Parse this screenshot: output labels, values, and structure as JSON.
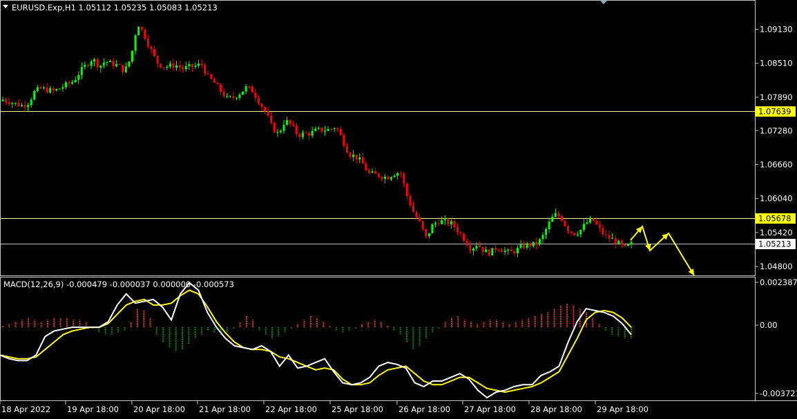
{
  "header": {
    "symbol_line": "EURUSD.Exp,H1  1.05112 1.05235 1.05083 1.05213",
    "macd_line": "MACD(12,26,9) -0.000479 -0.000037 0.000000 -0.000573"
  },
  "colors": {
    "background": "#000000",
    "bull": "#00ff00",
    "bear": "#ff0000",
    "hline": "#ffff99",
    "price_line": "#c0c0c0",
    "macd_line": "#ffffff",
    "signal_line": "#ffff00",
    "hist_pos": "#ff4040",
    "hist_neg": "#00a000",
    "arrow": "#ffff00",
    "label_yellow": "#ffff00"
  },
  "chart_data": {
    "type": "candlestick",
    "price_axis": {
      "ticks": [
        "1.09130",
        "1.08510",
        "1.07890",
        "1.07280",
        "1.06660",
        "1.06040",
        "1.05420",
        "1.04800"
      ],
      "ylim": [
        1.0465,
        1.0964
      ]
    },
    "time_axis": {
      "ticks": [
        "18 Apr 2022",
        "19 Apr 18:00",
        "20 Apr 18:00",
        "21 Apr 18:00",
        "22 Apr 18:00",
        "25 Apr 18:00",
        "26 Apr 18:00",
        "27 Apr 18:00",
        "28 Apr 18:00",
        "29 Apr 18:00"
      ]
    },
    "horizontal_levels": [
      {
        "label": "1.07639",
        "value": 1.07639,
        "highlight": true
      },
      {
        "label": "1.05678",
        "value": 1.05678,
        "highlight": true
      },
      {
        "label": "1.05213",
        "value": 1.05213,
        "highlight": false
      }
    ],
    "close_path": [
      1.0785,
      1.0781,
      1.0777,
      1.0774,
      1.0779,
      1.08,
      1.0805,
      1.0802,
      1.08,
      1.0806,
      1.0812,
      1.0818,
      1.0835,
      1.0848,
      1.086,
      1.0845,
      1.0855,
      1.085,
      1.0847,
      1.0836,
      1.0862,
      1.0925,
      1.0904,
      1.0878,
      1.0853,
      1.0845,
      1.0846,
      1.0848,
      1.0841,
      1.0844,
      1.0846,
      1.0849,
      1.0826,
      1.0815,
      1.08,
      1.0786,
      1.0789,
      1.0797,
      1.0807,
      1.08,
      1.078,
      1.0761,
      1.0734,
      1.0721,
      1.0747,
      1.0738,
      1.072,
      1.0722,
      1.0723,
      1.0729,
      1.0729,
      1.073,
      1.0736,
      1.071,
      1.0685,
      1.0681,
      1.067,
      1.065,
      1.0648,
      1.0645,
      1.0643,
      1.065,
      1.0652,
      1.061,
      1.058,
      1.056,
      1.0532,
      1.0555,
      1.0563,
      1.0561,
      1.0558,
      1.0545,
      1.053,
      1.0512,
      1.0522,
      1.0508,
      1.0505,
      1.0515,
      1.051,
      1.0505,
      1.0509,
      1.0517,
      1.052,
      1.052,
      1.053,
      1.0555,
      1.0575,
      1.0571,
      1.0549,
      1.054,
      1.0545,
      1.056,
      1.0565,
      1.0548,
      1.0535,
      1.053,
      1.0522,
      1.0513,
      1.0521
    ],
    "macd": {
      "ylim": [
        -0.003721,
        0.002387
      ],
      "ticks": [
        "0.002387",
        "0.00",
        "-0.003721"
      ],
      "macd_path": [
        -0.0015,
        -0.0017,
        -0.0018,
        -0.0018,
        -0.0015,
        -0.0005,
        -0.0002,
        -0.0001,
        0.0,
        0.0,
        0.0,
        0.0,
        0.0003,
        0.0012,
        0.0018,
        0.0013,
        0.0014,
        0.0015,
        0.0011,
        0.0004,
        0.0018,
        0.0024,
        0.002,
        0.0008,
        0.0,
        -0.0006,
        -0.001,
        -0.0011,
        -0.0012,
        -0.001,
        -0.0013,
        -0.0021,
        -0.0015,
        -0.0022,
        -0.0021,
        -0.0019,
        -0.0017,
        -0.0024,
        -0.003,
        -0.0031,
        -0.003,
        -0.0027,
        -0.0021,
        -0.0019,
        -0.002,
        -0.0022,
        -0.003,
        -0.0032,
        -0.0029,
        -0.0029,
        -0.0027,
        -0.0025,
        -0.0028,
        -0.0034,
        -0.0038,
        -0.0035,
        -0.0034,
        -0.0032,
        -0.0031,
        -0.0031,
        -0.0026,
        -0.0024,
        -0.0021,
        -0.0008,
        0.0003,
        0.001,
        0.0009,
        0.0008,
        0.0006,
        0.0002,
        -0.0004
      ],
      "signal_path": [
        -0.0015,
        -0.0016,
        -0.0017,
        -0.0017,
        -0.0016,
        -0.0012,
        -0.0008,
        -0.0004,
        -0.0002,
        -0.0001,
        0.0,
        0.0,
        0.0002,
        0.0007,
        0.0012,
        0.0014,
        0.0015,
        0.0012,
        0.0012,
        0.0013,
        0.0017,
        0.002,
        0.0018,
        0.0011,
        0.0003,
        -0.0003,
        -0.0008,
        -0.0011,
        -0.0012,
        -0.0012,
        -0.0013,
        -0.0016,
        -0.0017,
        -0.0019,
        -0.0021,
        -0.0023,
        -0.0022,
        -0.0023,
        -0.0028,
        -0.0031,
        -0.0031,
        -0.003,
        -0.0026,
        -0.0023,
        -0.0022,
        -0.0021,
        -0.0025,
        -0.0029,
        -0.0031,
        -0.0031,
        -0.0029,
        -0.0027,
        -0.0027,
        -0.003,
        -0.0033,
        -0.0034,
        -0.0035,
        -0.0034,
        -0.0033,
        -0.0032,
        -0.003,
        -0.0027,
        -0.0024,
        -0.0015,
        -0.0006,
        0.0004,
        0.0008,
        0.0009,
        0.0008,
        0.0005,
        0.0
      ],
      "histogram": [
        0.0001,
        0.0002,
        0.0003,
        0.0004,
        0.0005,
        0.0004,
        0.0003,
        0.0004,
        0.0005,
        0.0005,
        0.0005,
        0.0004,
        0.0004,
        0.0003,
        -0.0001,
        -0.0003,
        -0.0004,
        -0.0004,
        -0.0003,
        -0.0002,
        0.0003,
        0.001,
        0.0009,
        0.0005,
        -0.0004,
        -0.0008,
        -0.0011,
        -0.0013,
        -0.0012,
        -0.0009,
        -0.0006,
        -0.0004,
        -0.0002,
        -0.0003,
        -0.0004,
        -0.0003,
        -0.0001,
        0.0003,
        0.0006,
        0.0004,
        -0.0002,
        -0.0004,
        -0.0006,
        -0.0005,
        -0.0003,
        -0.0001,
        0.0002,
        0.0004,
        0.0006,
        0.0005,
        0.0003,
        0.0001,
        -0.0002,
        -0.0003,
        -0.0002,
        -0.0001,
        0.0002,
        0.0003,
        0.0004,
        0.0003,
        0.0001,
        -0.0002,
        -0.0004,
        -0.0008,
        -0.0012,
        -0.001,
        -0.0006,
        -0.0003,
        -0.0001,
        0.0003,
        0.0005,
        0.0006,
        0.0004,
        0.0003,
        0.0002,
        0.0003,
        0.0004,
        0.0004,
        0.0003,
        0.0002,
        0.0003,
        0.0004,
        0.0005,
        0.0006,
        0.0007,
        0.0008,
        0.001,
        0.0012,
        0.0013,
        0.0012,
        0.001,
        0.0008,
        0.0005,
        0.0002,
        -0.0002,
        -0.0004,
        -0.0005,
        -0.0006,
        -0.0006
      ]
    }
  }
}
